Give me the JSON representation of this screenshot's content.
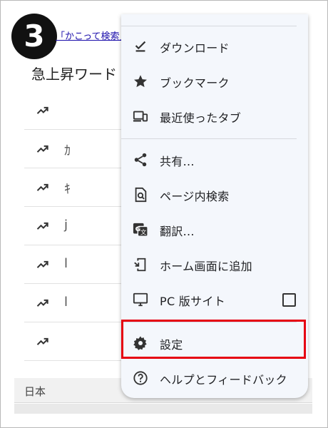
{
  "step": {
    "number": "3"
  },
  "background": {
    "search_link": "「かこって検索」",
    "trending_title": "急上昇ワード",
    "trend_rows": [
      {
        "glyph": ""
      },
      {
        "glyph": "ｶ"
      },
      {
        "glyph": "ｷ"
      },
      {
        "glyph": "j"
      },
      {
        "glyph": "l"
      },
      {
        "glyph": "l"
      },
      {
        "glyph": ""
      }
    ],
    "region": "日本"
  },
  "menu": {
    "items": [
      {
        "label": "ダウンロード",
        "icon": "download-done-icon"
      },
      {
        "label": "ブックマーク",
        "icon": "star-icon"
      },
      {
        "label": "最近使ったタブ",
        "icon": "devices-icon"
      },
      {
        "label": "共有...",
        "icon": "share-icon"
      },
      {
        "label": "ページ内検索",
        "icon": "find-in-page-icon"
      },
      {
        "label": "翻訳...",
        "icon": "translate-icon"
      },
      {
        "label": "ホーム画面に追加",
        "icon": "add-to-home-screen-icon"
      },
      {
        "label": "PC 版サイト",
        "icon": "desktop-icon",
        "checked": false
      },
      {
        "label": "設定",
        "icon": "gear-icon",
        "highlighted": true
      },
      {
        "label": "ヘルプとフィードバック",
        "icon": "help-icon"
      }
    ]
  },
  "colors": {
    "menu_background": "#f4f7fc",
    "highlight_border": "#e60012",
    "link": "#1a0dab"
  }
}
